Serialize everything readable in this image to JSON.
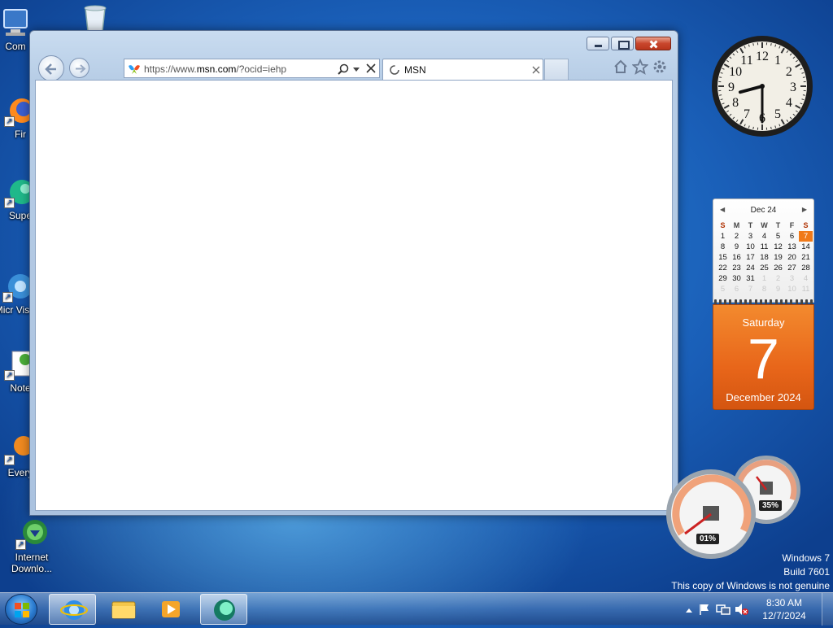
{
  "desktop": {
    "icons": [
      {
        "label": "Com",
        "icon": "computer-icon"
      },
      {
        "label": "",
        "icon": "recycle-bin-icon"
      },
      {
        "label": "Fir",
        "icon": "firefox-icon"
      },
      {
        "label": "Supe",
        "icon": "app-icon"
      },
      {
        "label": "Micr Visual",
        "icon": "visual-studio-icon"
      },
      {
        "label": "Note",
        "icon": "notepad-icon"
      },
      {
        "label": "Every",
        "icon": "everything-icon"
      },
      {
        "label": "Internet Downlo...",
        "icon": "internet-download-manager-icon"
      }
    ]
  },
  "browser": {
    "address": {
      "prefix": "https://www.",
      "domain": "msn.com",
      "suffix": "/?ocid=iehp"
    },
    "tab": {
      "title": "MSN"
    },
    "toolbar": {
      "home": "home-icon",
      "favorites": "star-icon",
      "tools": "gear-icon"
    }
  },
  "clock": {
    "hour": 8,
    "minute": 30,
    "numerals": [
      "12",
      "1",
      "2",
      "3",
      "4",
      "5",
      "6",
      "7",
      "8",
      "9",
      "10",
      "11"
    ]
  },
  "calendar": {
    "month_label": "Dec 24",
    "weekdays": [
      "S",
      "M",
      "T",
      "W",
      "T",
      "F",
      "S"
    ],
    "weeks": [
      [
        "1",
        "2",
        "3",
        "4",
        "5",
        "6",
        "7"
      ],
      [
        "8",
        "9",
        "10",
        "11",
        "12",
        "13",
        "14"
      ],
      [
        "15",
        "16",
        "17",
        "18",
        "19",
        "20",
        "21"
      ],
      [
        "22",
        "23",
        "24",
        "25",
        "26",
        "27",
        "28"
      ],
      [
        "29",
        "30",
        "31",
        "1",
        "2",
        "3",
        "4"
      ],
      [
        "5",
        "6",
        "7",
        "8",
        "9",
        "10",
        "11"
      ]
    ],
    "today": "7",
    "day_name": "Saturday",
    "day_number": "7",
    "month_year": "December 2024"
  },
  "meters": {
    "cpu_percent": "01%",
    "memory_percent": "35%"
  },
  "watermark": {
    "line1": "Windows 7",
    "line2": "Build 7601",
    "line3": "This copy of Windows is not genuine"
  },
  "taskbar": {
    "time": "8:30 AM",
    "date": "12/7/2024",
    "apps": [
      "internet-explorer-icon",
      "file-explorer-icon",
      "media-player-icon",
      "app-icon"
    ]
  }
}
